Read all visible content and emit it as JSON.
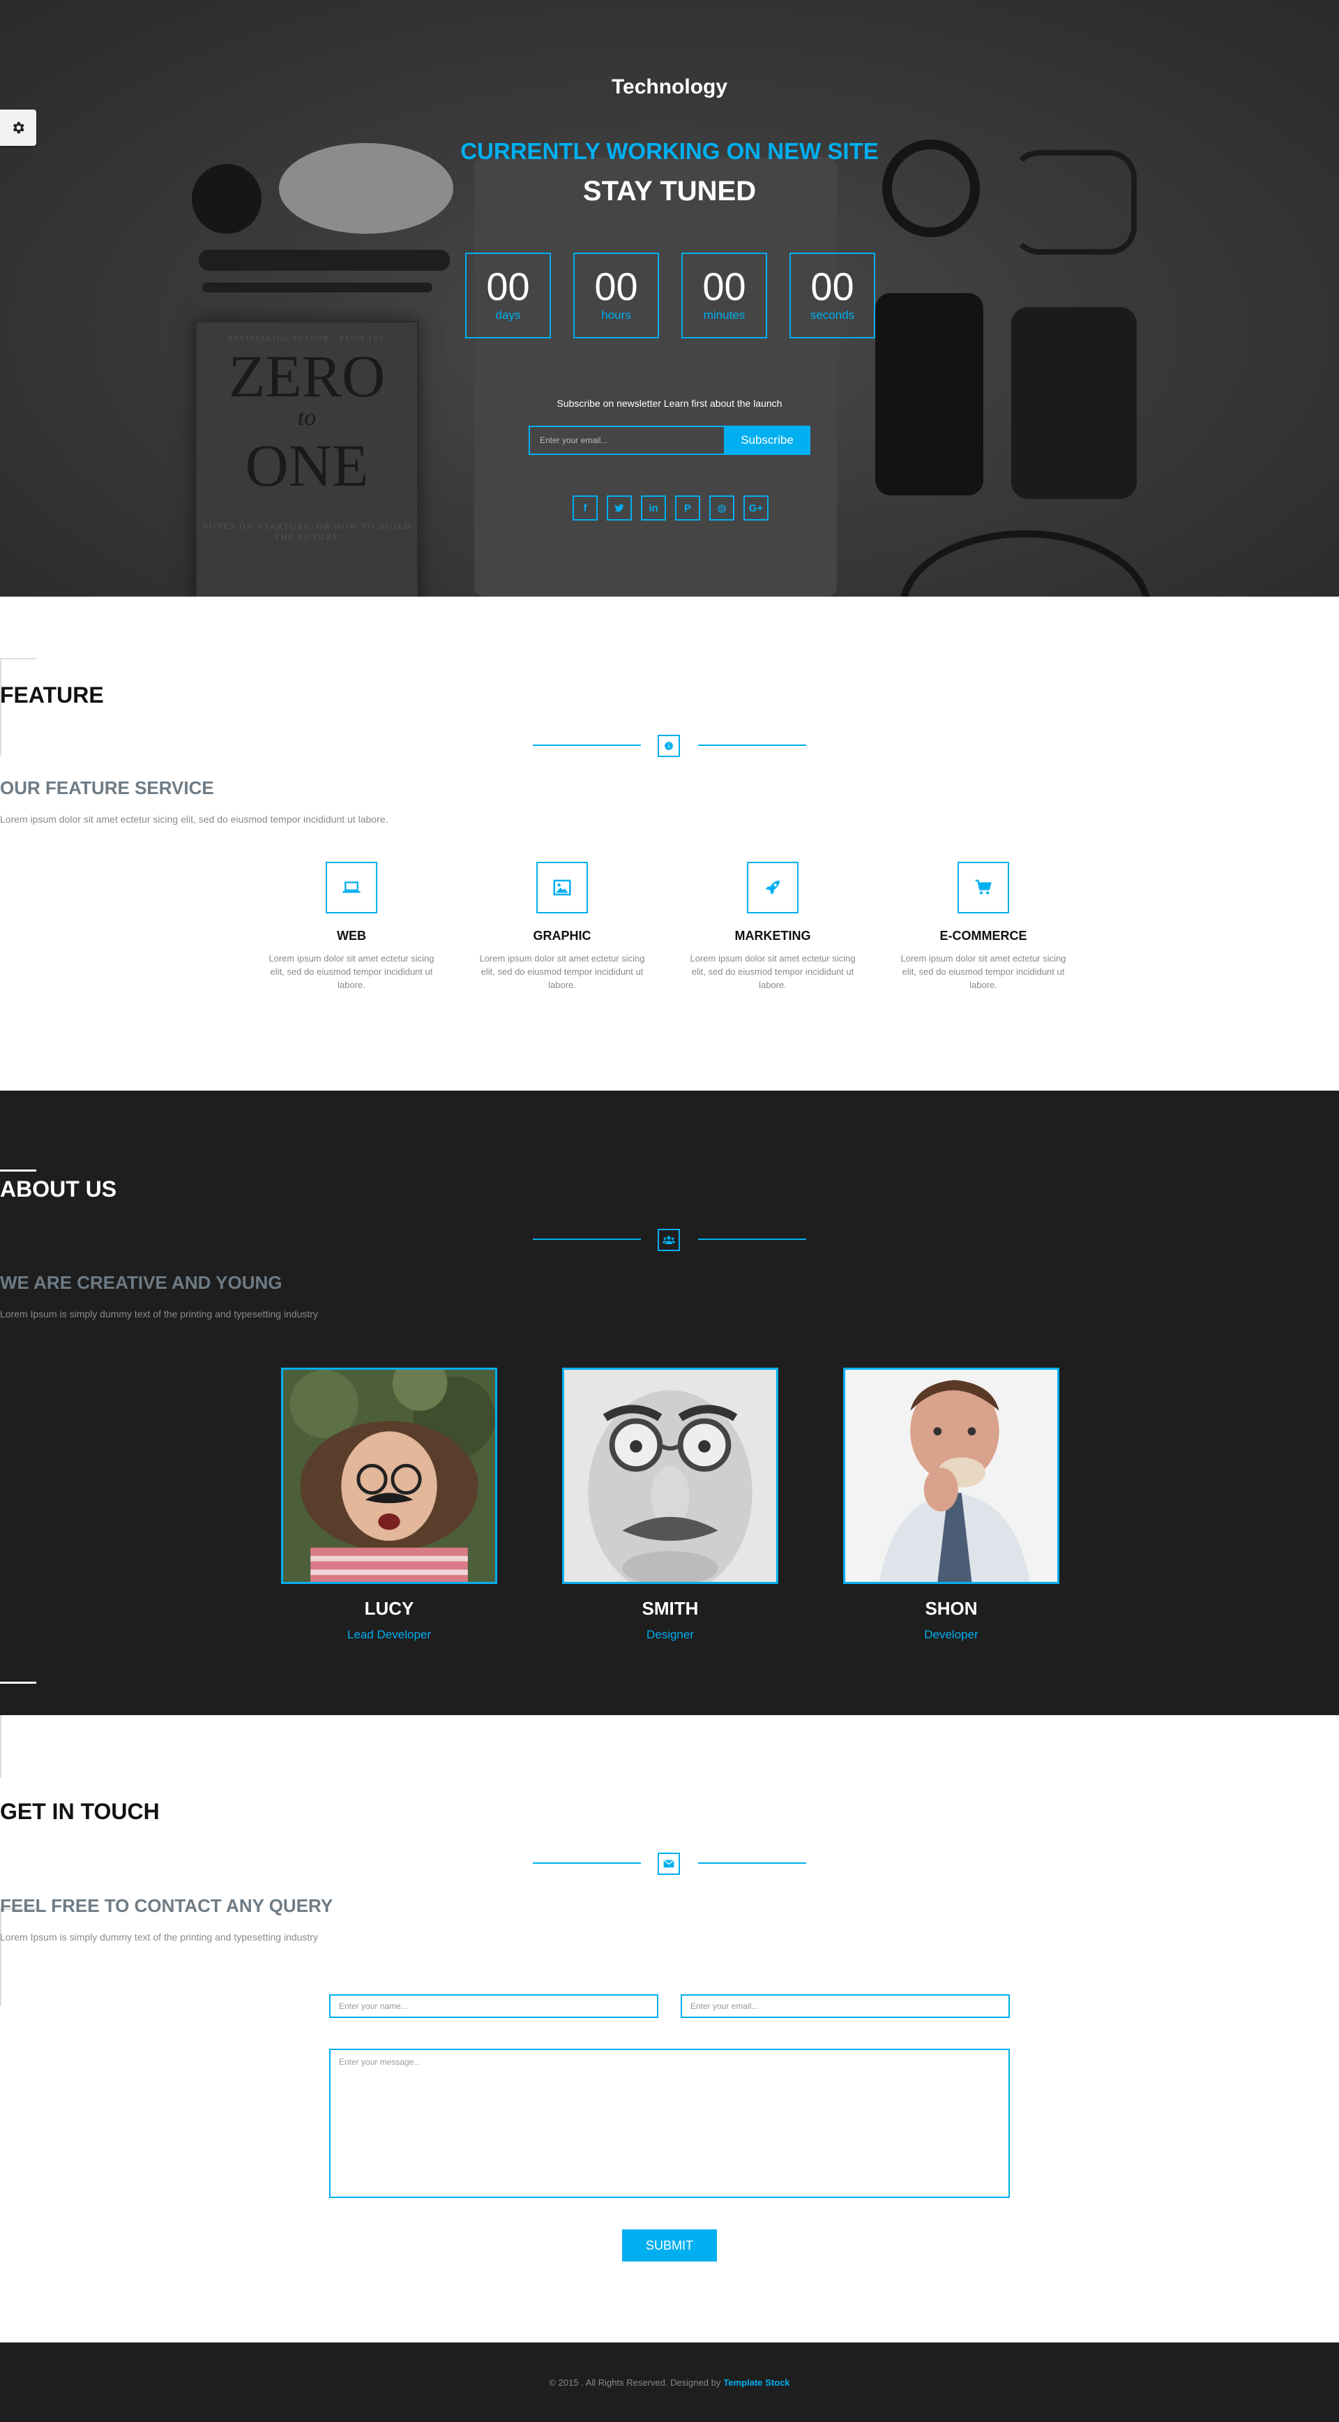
{
  "colors": {
    "accent": "#00aff0",
    "dark_bg": "#1e1e1e"
  },
  "settings": {
    "icon": "gear-icon"
  },
  "hero": {
    "logo": "Technology",
    "subtitle": "CURRENTLY WORKING ON NEW SITE",
    "title": "STAY TUNED",
    "countdown": [
      {
        "value": "00",
        "label": "days"
      },
      {
        "value": "00",
        "label": "hours"
      },
      {
        "value": "00",
        "label": "minutes"
      },
      {
        "value": "00",
        "label": "seconds"
      }
    ],
    "newsletter_text": "Subscribe on newsletter Learn first about the launch",
    "email_placeholder": "Enter your email...",
    "subscribe_label": "Subscribe",
    "socials": [
      {
        "icon": "facebook-icon",
        "glyph": "f"
      },
      {
        "icon": "twitter-icon",
        "glyph": "t"
      },
      {
        "icon": "linkedin-icon",
        "glyph": "in"
      },
      {
        "icon": "pinterest-icon",
        "glyph": "P"
      },
      {
        "icon": "dribbble-icon",
        "glyph": "◍"
      },
      {
        "icon": "google-plus-icon",
        "glyph": "G+"
      }
    ],
    "book": {
      "line1": "BESTSELLING AUTHOR · FROM THE",
      "line2": "ZERO",
      "line3": "to",
      "line4": "ONE",
      "line5": "NOTES ON STARTUPS, OR HOW TO BUILD THE FUTURE"
    }
  },
  "feature": {
    "title": "FEATURE",
    "divider_icon": "info-icon",
    "subtitle": "OUR FEATURE SERVICE",
    "description": "Lorem ipsum dolor sit amet ectetur sicing elit, sed do eiusmod tempor incididunt ut labore.",
    "items": [
      {
        "icon": "laptop-icon",
        "title": "WEB",
        "text": "Lorem ipsum dolor sit amet ectetur sicing elit, sed do eiusmod tempor incididunt ut labore."
      },
      {
        "icon": "image-icon",
        "title": "GRAPHIC",
        "text": "Lorem ipsum dolor sit amet ectetur sicing elit, sed do eiusmod tempor incididunt ut labore."
      },
      {
        "icon": "rocket-icon",
        "title": "MARKETING",
        "text": "Lorem ipsum dolor sit amet ectetur sicing elit, sed do eiusmod tempor incididunt ut labore."
      },
      {
        "icon": "cart-icon",
        "title": "E-COMMERCE",
        "text": "Lorem ipsum dolor sit amet ectetur sicing elit, sed do eiusmod tempor incididunt ut labore."
      }
    ]
  },
  "about": {
    "title": "ABOUT US",
    "divider_icon": "users-icon",
    "subtitle": "WE ARE CREATIVE AND YOUNG",
    "description": "Lorem Ipsum is simply dummy text of the printing and typesetting industry",
    "team": [
      {
        "name": "LUCY",
        "role": "Lead Developer"
      },
      {
        "name": "SMITH",
        "role": "Designer"
      },
      {
        "name": "SHON",
        "role": "Developer"
      }
    ]
  },
  "contact": {
    "title": "GET IN TOUCH",
    "divider_icon": "envelope-icon",
    "subtitle": "FEEL FREE TO CONTACT ANY QUERY",
    "description": "Lorem Ipsum is simply dummy text of the printing and typesetting industry",
    "name_placeholder": "Enter your name...",
    "email_placeholder": "Enter your email...",
    "message_placeholder": "Enter your message...",
    "submit_label": "SUBMIT"
  },
  "footer": {
    "text": "© 2015 . All Rights Reserved. Designed by",
    "link": "Template Stock"
  }
}
